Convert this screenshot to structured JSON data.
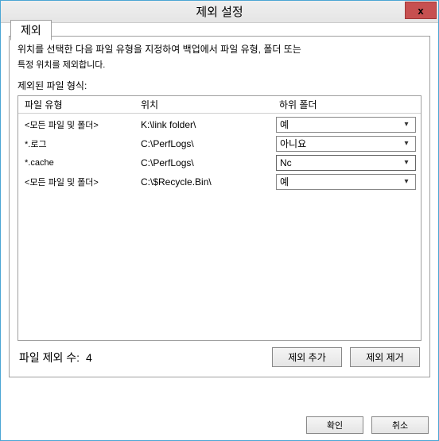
{
  "titlebar": {
    "title": "제외 설정",
    "close_label": "x"
  },
  "tab": {
    "label": "제외",
    "description_line1": "위치를 선택한 다음 파일 유형을 지정하여 백업에서 파일 유형, 폴더 또는",
    "description_line2": "특정 위치를 제외합니다.",
    "section_label": "제외된 파일 형식:"
  },
  "table": {
    "header": {
      "type": "파일 유형",
      "location": "위치",
      "subfolder": "하위 폴더"
    },
    "rows": [
      {
        "type": "<모든 파일 및 폴더>",
        "location": "K:\\link folder\\",
        "sub": "예"
      },
      {
        "type": "*.로그",
        "location": "C:\\PerfLogs\\",
        "sub": "아니요"
      },
      {
        "type": "*.cache",
        "location": "C:\\PerfLogs\\",
        "sub": "Nc",
        "editing": true
      },
      {
        "type": "<모든 파일 및 폴더>",
        "location": "C:\\$Recycle.Bin\\",
        "sub": "예"
      }
    ]
  },
  "footer": {
    "count_label": "파일 제외 수:",
    "count": 4,
    "add_button": "제외 추가",
    "remove_button": "제외 제거"
  },
  "dialog": {
    "ok": "확인",
    "cancel": "취소"
  }
}
